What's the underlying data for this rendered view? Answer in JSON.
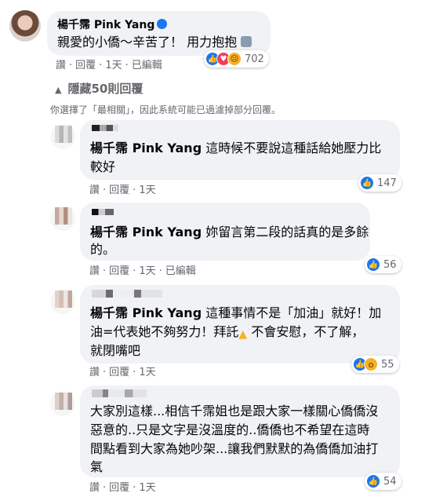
{
  "main_comment": {
    "author": "楊千霈 Pink Yang",
    "text": "親愛的小僑～辛苦了！ 用力抱抱",
    "actions": [
      "讚",
      "回覆",
      "1天",
      "已編輯"
    ],
    "reactions": [
      "like",
      "love",
      "sad"
    ],
    "reaction_count": "702"
  },
  "hidden_replies": {
    "label": "隱藏50則回覆"
  },
  "filter_notice": "你選擇了「最相關」，因此系統可能已過濾掉部分回覆。",
  "replies": [
    {
      "tag": "楊千霈 Pink Yang",
      "text_line1": " 這時候不要說這種話給她壓力比",
      "text_line2": "較好",
      "actions": [
        "讚",
        "回覆",
        "1天"
      ],
      "reaction_count": "147"
    },
    {
      "tag": "楊千霈 Pink Yang",
      "text_line1": " 妳留言第二段的話真的是多餘",
      "text_line2": "的。",
      "actions": [
        "讚",
        "回覆",
        "1天",
        "已編輯"
      ],
      "reaction_count": "56"
    },
    {
      "tag": "楊千霈 Pink Yang",
      "text_line1": " 這種事情不是「加油」就好！加",
      "text_line2": "油=代表她不夠努力！拜託",
      "text_line2b": "不會安慰，不了解，",
      "text_line3": "就閉嘴吧",
      "actions": [
        "讚",
        "回覆",
        "1天"
      ],
      "reaction_count": "55"
    },
    {
      "text_line1": "大家別這樣...相信千霈姐也是跟大家一樣關心僑僑沒",
      "text_line2": "惡意的..只是文字是沒溫度的..僑僑也不希望在這時",
      "text_line3": "間點看到大家為她吵架...讓我們默默的為僑僑加油打",
      "text_line4": "氣",
      "actions": [
        "讚",
        "回覆",
        "1天"
      ],
      "reaction_count": "54"
    }
  ],
  "colors": {
    "bubble": "#f0f2f5",
    "secondary_text": "#65676b",
    "like_blue": "#1877f2",
    "love_red": "#f33e58",
    "haha_yellow": "#f7b125"
  }
}
